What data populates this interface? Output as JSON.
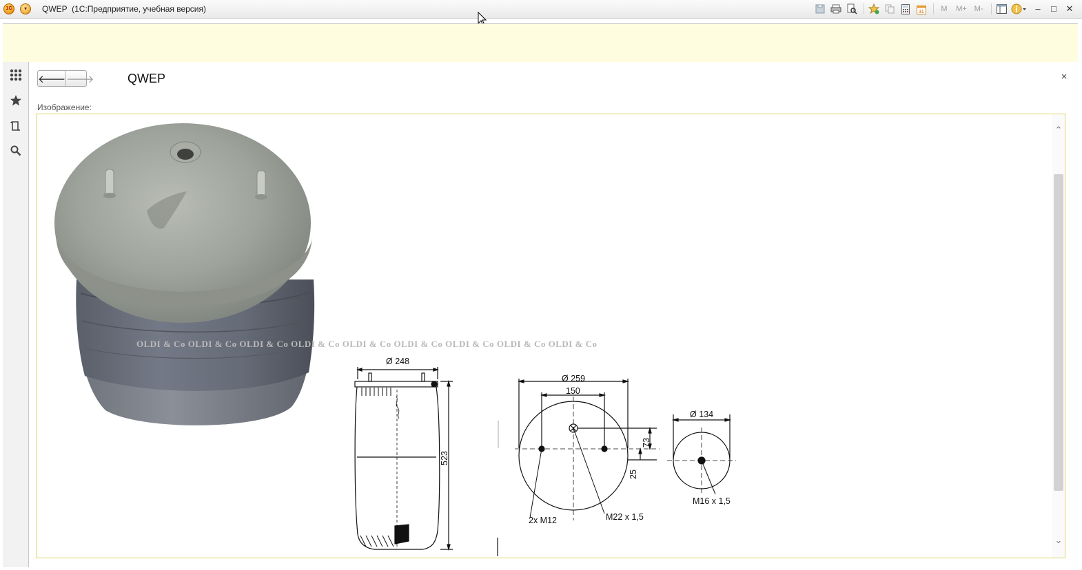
{
  "window": {
    "title": "QWEP  (1С:Предприятие, учебная версия)",
    "tools": [
      "save-icon",
      "print-icon",
      "preview-icon",
      "favorite-add-icon",
      "copy-icon",
      "calculator-icon",
      "calendar-icon"
    ],
    "memory_buttons": [
      "M",
      "M+",
      "M-"
    ],
    "controls": [
      "minimize-icon",
      "maximize-icon",
      "close-icon"
    ]
  },
  "sidebar": {
    "items": [
      "apps-grid-icon",
      "favorites-star-icon",
      "history-icon",
      "search-icon"
    ]
  },
  "form": {
    "title": "QWEP",
    "back_glyph": "🡐",
    "forward_glyph": "🡒",
    "close_glyph": "×",
    "image_field_label": "Изображение:"
  },
  "picture": {
    "watermark": "OLDI & Co  OLDI & Co  OLDI & Co  OLDI & Co  OLDI & Co  OLDI & Co  OLDI & Co  OLDI & Co  OLDI & Co",
    "dimensions": {
      "diameter_top": "Ø 248",
      "height": "523",
      "diameter_plate": "Ø 259",
      "bolt_spacing": "150",
      "offset_73": "73",
      "offset_25": "25",
      "studs": "2x M12",
      "air_port": "M22 x 1,5",
      "diameter_bottom": "Ø 134",
      "bottom_thread": "M16 x 1,5"
    }
  },
  "colors": {
    "message_panel": "#fffde0",
    "frame_border": "#e2d46a",
    "watermark": "#b9b9b9"
  }
}
